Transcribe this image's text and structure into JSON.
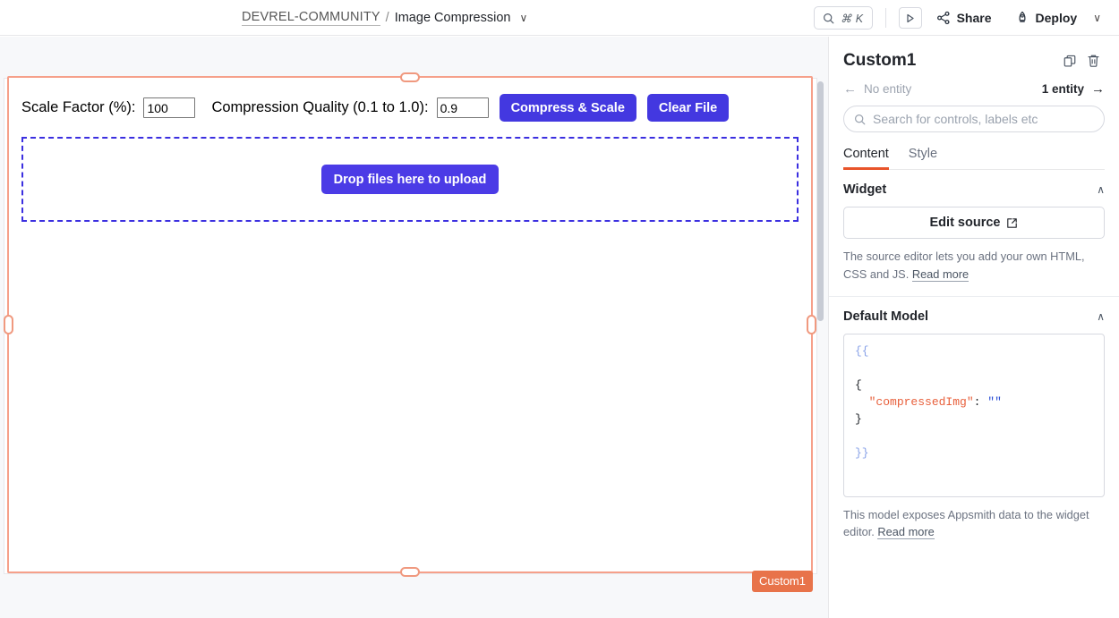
{
  "topbar": {
    "breadcrumb": {
      "app": "DEVREL-COMMUNITY",
      "separator": "/",
      "page": "Image Compression",
      "caret": "∨"
    },
    "search": {
      "icon": "search-icon",
      "shortcut": "⌘ K"
    },
    "play_icon": "play-triangle-icon",
    "share": {
      "label": "Share",
      "icon": "share-nodes-icon"
    },
    "deploy": {
      "label": "Deploy",
      "icon": "rocket-icon"
    },
    "deploy_caret": "∨"
  },
  "canvas": {
    "widget_badge": "Custom1",
    "form": {
      "scale_label": "Scale Factor (%):",
      "scale_value": "100",
      "quality_label": "Compression Quality (0.1 to 1.0):",
      "quality_value": "0.9",
      "compress_button": "Compress & Scale",
      "clear_button": "Clear File",
      "drop_button": "Drop files here to upload"
    }
  },
  "panel": {
    "title": "Custom1",
    "copy_icon": "copy-icon",
    "delete_icon": "trash-icon",
    "entity_prev": "No entity",
    "entity_next": "1 entity",
    "arrow_left": "→",
    "arrow_right": "→",
    "search_placeholder": "Search for controls, labels etc",
    "tabs": [
      {
        "label": "Content",
        "active": true
      },
      {
        "label": "Style",
        "active": false
      }
    ],
    "widget_section": {
      "title": "Widget",
      "collapse_caret": "∧",
      "edit_source_label": "Edit source",
      "external_icon": "external-link-icon",
      "help_text": "The source editor lets you add your own HTML, CSS and JS. ",
      "help_link": "Read more"
    },
    "model_section": {
      "title": "Default Model",
      "collapse_caret": "∧",
      "code": {
        "line1": "{{",
        "line2": "",
        "line3": "{",
        "line4_key": "\"compressedImg\"",
        "line4_colon": ":",
        "line4_val": "\"\"",
        "line5": "}",
        "line6": "",
        "line7": "}}"
      },
      "help_text": "This model exposes Appsmith data to the widget editor. ",
      "help_link": "Read more"
    }
  },
  "colors": {
    "accent_blue": "#4338e0",
    "selection_orange": "#f0997f",
    "badge_orange": "#e8734a",
    "tab_underline": "#e8542a",
    "dropzone_border": "#3b2fe0"
  }
}
